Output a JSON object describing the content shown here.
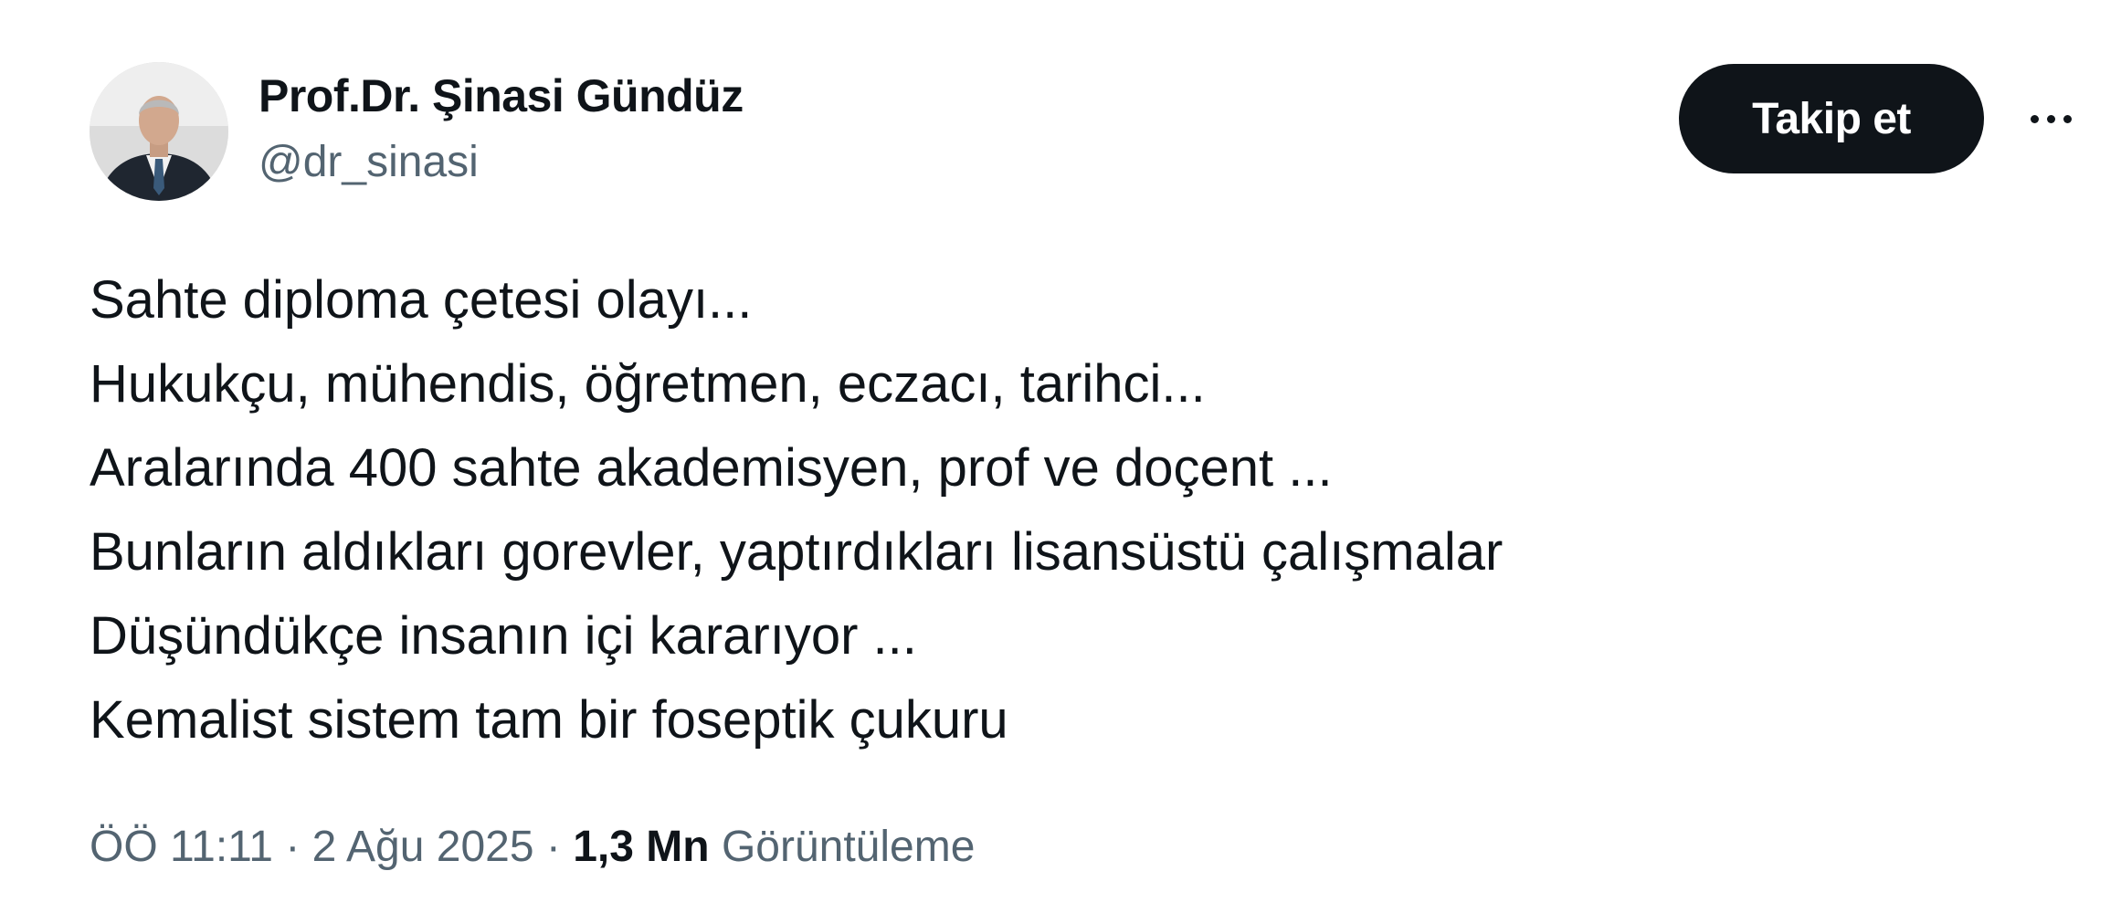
{
  "author": {
    "display_name": "Prof.Dr. Şinasi Gündüz",
    "handle": "@dr_sinasi",
    "avatar_icon": "profile-photo"
  },
  "actions": {
    "follow_label": "Takip et",
    "more_icon": "more-horizontal-icon"
  },
  "tweet": {
    "lines": [
      "Sahte diploma çetesi olayı...",
      "Hukukçu, mühendis, öğretmen, eczacı, tarihci...",
      "Aralarında 400 sahte akademisyen, prof ve doçent ...",
      "Bunların aldıkları gorevler, yaptırdıkları lisansüstü çalışmalar",
      "Düşündükçe insanın içi kararıyor ...",
      "Kemalist sistem tam bir foseptik çukuru"
    ]
  },
  "meta": {
    "time": "ÖÖ 11:11",
    "separator": " · ",
    "date": "2 Ağu 2025",
    "views_count": "1,3 Mn",
    "views_label": "Görüntüleme"
  },
  "colors": {
    "text_primary": "#0f1419",
    "text_secondary": "#536471",
    "button_bg": "#0f1419",
    "background": "#ffffff"
  }
}
